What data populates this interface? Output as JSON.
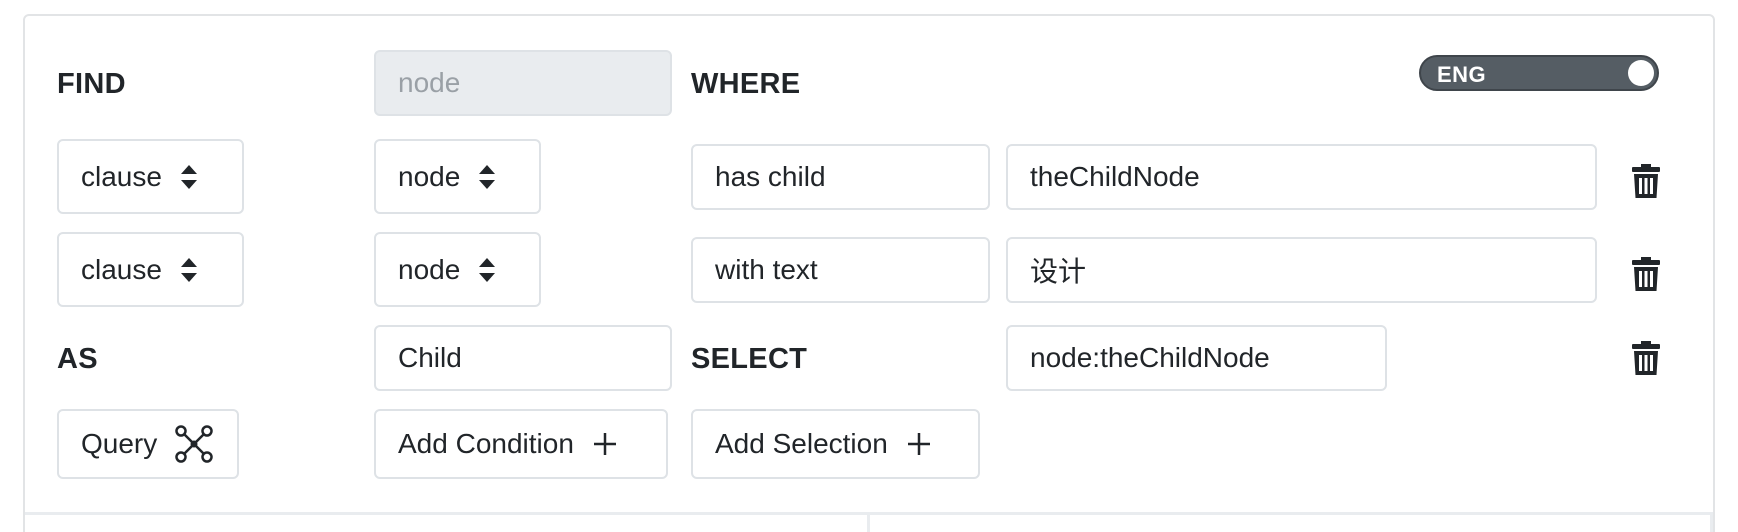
{
  "labels": {
    "find": "FIND",
    "where": "WHERE",
    "as": "AS",
    "select": "SELECT"
  },
  "find_input": {
    "placeholder": "node"
  },
  "toggle": {
    "label": "ENG",
    "on": true
  },
  "conditions": [
    {
      "clause": "clause",
      "target": "node",
      "predicate": "has child",
      "value": "theChildNode"
    },
    {
      "clause": "clause",
      "target": "node",
      "predicate": "with text",
      "value": "设计"
    }
  ],
  "as_input": {
    "value": "Child"
  },
  "selection": {
    "value": "node:theChildNode"
  },
  "buttons": {
    "query": "Query",
    "add_condition": "Add Condition",
    "add_selection": "Add Selection"
  },
  "icons": {
    "select_arrows": "updown-arrows-icon",
    "trash": "trash-icon",
    "query": "graph-nodes-icon",
    "plus": "plus-icon"
  }
}
